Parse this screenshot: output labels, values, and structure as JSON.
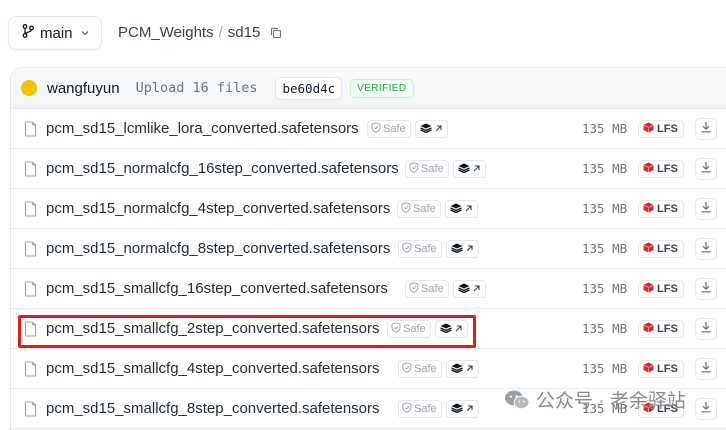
{
  "header": {
    "branch": "main",
    "breadcrumb": {
      "repo": "PCM_Weights",
      "separator": "/",
      "folder": "sd15"
    }
  },
  "commit": {
    "author": "wangfuyun",
    "message": "Upload 16 files",
    "hash": "be60d4c",
    "verified": "VERIFIED"
  },
  "files": [
    {
      "name": "pcm_sd15_lcmlike_lora_converted.safetensors",
      "safe": "Safe",
      "size": "135 MB",
      "lfs": "LFS"
    },
    {
      "name": "pcm_sd15_normalcfg_16step_converted.safetensors",
      "safe": "Safe",
      "size": "135 MB",
      "lfs": "LFS"
    },
    {
      "name": "pcm_sd15_normalcfg_4step_converted.safetensors",
      "safe": "Safe",
      "size": "135 MB",
      "lfs": "LFS"
    },
    {
      "name": "pcm_sd15_normalcfg_8step_converted.safetensors",
      "safe": "Safe",
      "size": "135 MB",
      "lfs": "LFS"
    },
    {
      "name": "pcm_sd15_smallcfg_16step_converted.safetensors",
      "safe": "Safe",
      "size": "135 MB",
      "lfs": "LFS"
    },
    {
      "name": "pcm_sd15_smallcfg_2step_converted.safetensors",
      "safe": "Safe",
      "size": "135 MB",
      "lfs": "LFS"
    },
    {
      "name": "pcm_sd15_smallcfg_4step_converted.safetensors",
      "safe": "Safe",
      "size": "135 MB",
      "lfs": "LFS"
    },
    {
      "name": "pcm_sd15_smallcfg_8step_converted.safetensors",
      "safe": "Safe",
      "size": "135 MB",
      "lfs": "LFS"
    }
  ],
  "highlighted_file_index": 5,
  "watermark": {
    "text": "公众号 · 老余驿站"
  },
  "colors": {
    "highlight": "#e31b1b",
    "verified": "#16a34a",
    "avatar": "#f2c200",
    "lfs_icon": "#dc2626"
  }
}
